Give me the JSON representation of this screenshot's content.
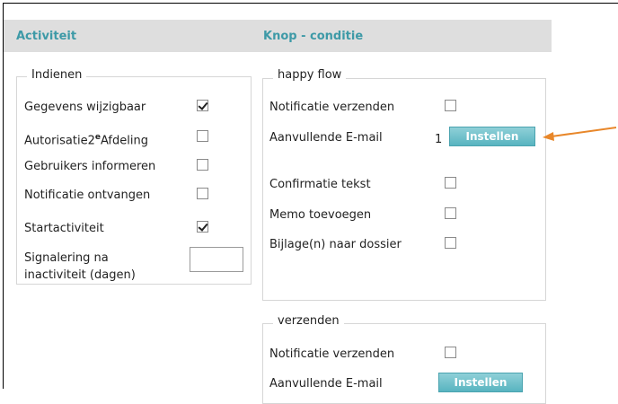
{
  "header": {
    "col1": "Activiteit",
    "col2": "Knop - conditie"
  },
  "left_group": {
    "legend": "Indienen",
    "items": [
      {
        "label": "Gegevens wijzigbaar",
        "checked": true
      },
      {
        "label_a": "Autorisatie2",
        "label_sup": "e",
        "label_b": "Afdeling",
        "checked": false
      },
      {
        "label": "Gebruikers informeren",
        "checked": false
      },
      {
        "label": "Notificatie ontvangen",
        "checked": false
      },
      {
        "label": "Startactiviteit",
        "checked": true
      }
    ],
    "signal_line1": "Signalering na",
    "signal_line2": "inactiviteit (dagen)",
    "signal_value": ""
  },
  "happy": {
    "legend": "happy flow",
    "notificatie": "Notificatie verzenden",
    "aanvullende": "Aanvullende E-mail",
    "count": "1",
    "button": "Instellen",
    "confirmatie": "Confirmatie tekst",
    "memo": "Memo toevoegen",
    "bijlage": "Bijlage(n) naar dossier"
  },
  "verzenden": {
    "legend": "verzenden",
    "notificatie": "Notificatie verzenden",
    "aanvullende": "Aanvullende E-mail",
    "button": "Instellen"
  },
  "colors": {
    "accent": "#3e9aa7",
    "arrow": "#e8872a",
    "header_bg": "#dedede"
  }
}
